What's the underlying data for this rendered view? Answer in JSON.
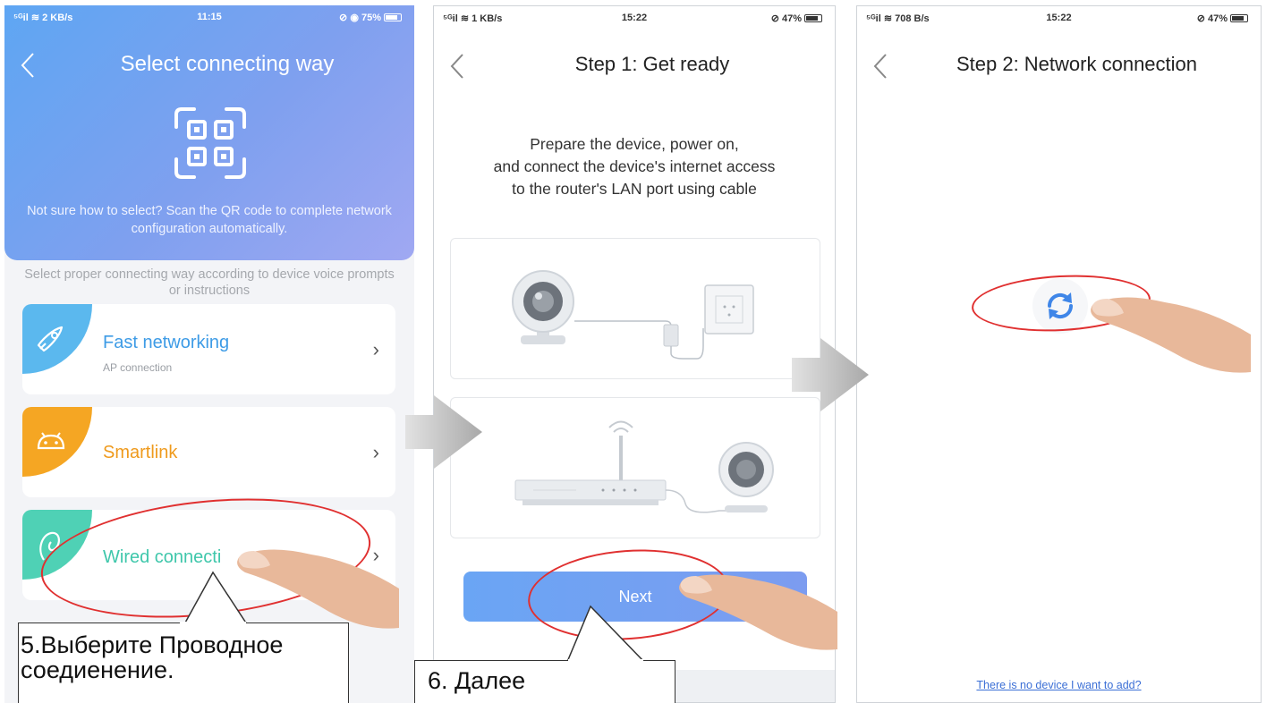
{
  "screen1": {
    "status": {
      "signal": "⁵ᴳil ≋ 2 KB/s",
      "time": "11:15",
      "battery": "⊘ ◉ 75%"
    },
    "title": "Select connecting way",
    "qr_help": "Not sure how to select? Scan the QR code to complete network configuration automatically.",
    "hint": "Select proper connecting way according to device voice prompts or instructions",
    "options": [
      {
        "label": "Fast networking",
        "sub": "AP connection",
        "color": "#5bb8ee",
        "label_color": "#3d9be6"
      },
      {
        "label": "Smartlink",
        "sub": "",
        "color": "#f5a623",
        "label_color": "#ef9a1c"
      },
      {
        "label": "Wired connecti",
        "sub": "",
        "color": "#4fd1b5",
        "label_color": "#3fc7ab"
      }
    ]
  },
  "screen2": {
    "status": {
      "signal": "⁵ᴳil ≋ 1 KB/s",
      "time": "15:22",
      "battery": "⊘ 47%"
    },
    "title": "Step 1: Get ready",
    "instructions": [
      "Prepare the device, power on,",
      "and connect the device's internet access",
      "to the router's LAN port using cable"
    ],
    "next_label": "Next"
  },
  "screen3": {
    "status": {
      "signal": "⁵ᴳil ≋ 708 B/s",
      "time": "15:22",
      "battery": "⊘ 47%"
    },
    "title": "Step 2: Network connection",
    "link": "There is no device I want to add?"
  },
  "callouts": {
    "step5": [
      "5.Выберите Проводное",
      "соедиенение."
    ],
    "step6": "6. Далее"
  },
  "colors": {
    "accent_blue": "#6aa5f4",
    "highlight_red": "#e03030"
  }
}
